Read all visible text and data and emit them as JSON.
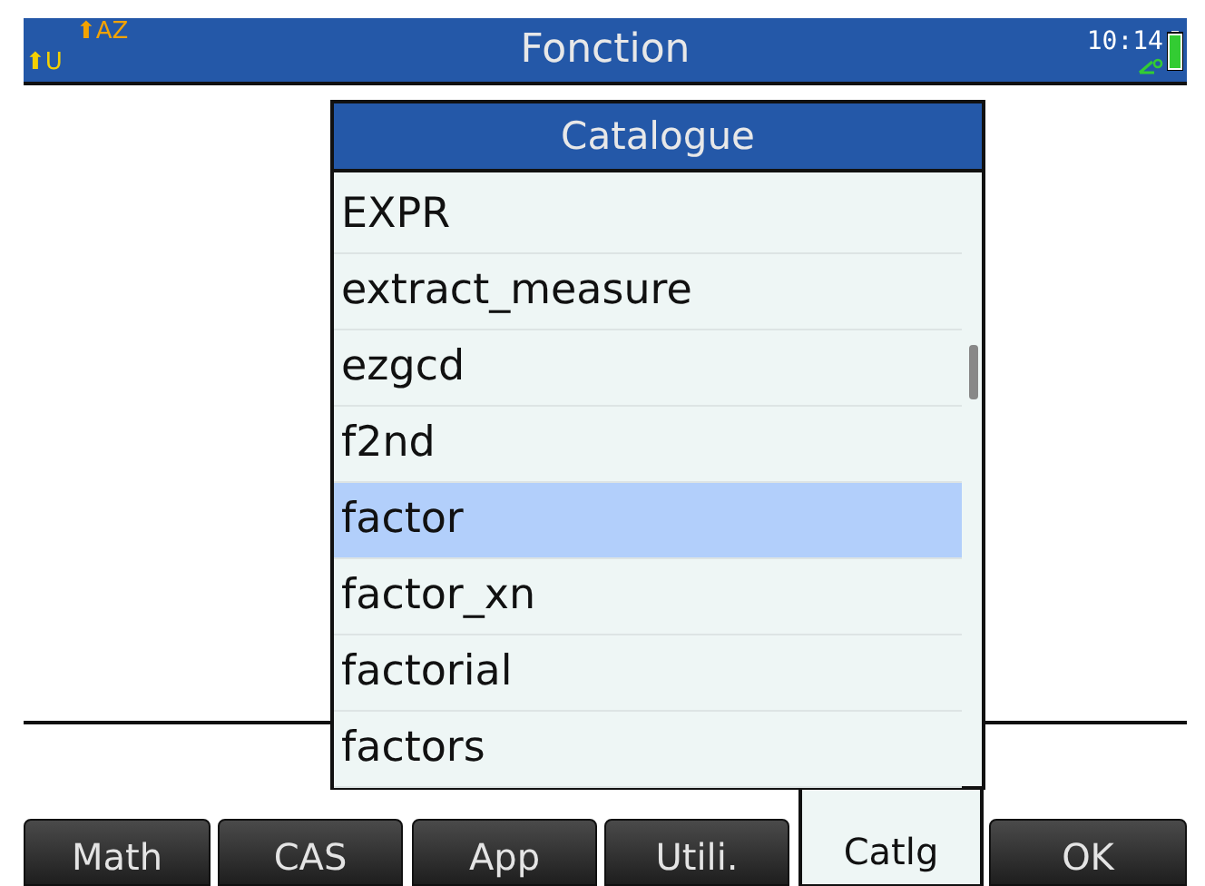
{
  "status_bar": {
    "shift_alpha": "⬆AZ",
    "shift_user": "⬆U",
    "title": "Fonction",
    "time": "10:14"
  },
  "catalogue": {
    "title": "Catalogue",
    "items": [
      {
        "label": "EXPR",
        "selected": false
      },
      {
        "label": "extract_measure",
        "selected": false
      },
      {
        "label": "ezgcd",
        "selected": false
      },
      {
        "label": "f2nd",
        "selected": false
      },
      {
        "label": "factor",
        "selected": true
      },
      {
        "label": "factor_xn",
        "selected": false
      },
      {
        "label": "factorial",
        "selected": false
      },
      {
        "label": "factors",
        "selected": false
      }
    ]
  },
  "menu": [
    {
      "label": "Math",
      "selected": false
    },
    {
      "label": "CAS",
      "selected": false
    },
    {
      "label": "App",
      "selected": false
    },
    {
      "label": "Utili.",
      "selected": false
    },
    {
      "label": "Catlg",
      "selected": true
    },
    {
      "label": "OK",
      "selected": false
    }
  ]
}
